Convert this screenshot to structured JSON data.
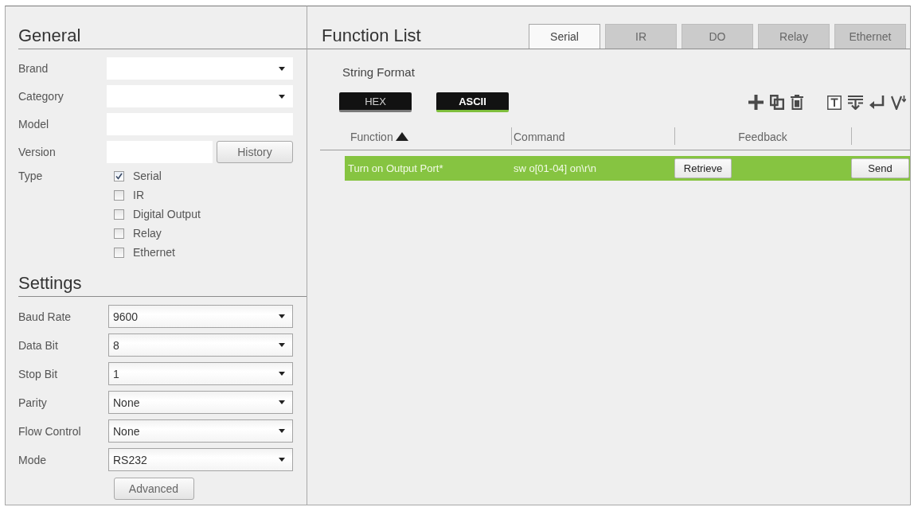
{
  "general": {
    "title": "General",
    "fields": [
      {
        "label": "Brand",
        "kind": "dropdown"
      },
      {
        "label": "Category",
        "kind": "dropdown"
      },
      {
        "label": "Model",
        "kind": "text"
      },
      {
        "label": "Version",
        "kind": "text_with_button",
        "button": "History"
      }
    ],
    "type": {
      "label": "Type",
      "options": [
        {
          "label": "Serial",
          "checked": true
        },
        {
          "label": "IR",
          "checked": false
        },
        {
          "label": "Digital Output",
          "checked": false
        },
        {
          "label": "Relay",
          "checked": false
        },
        {
          "label": "Ethernet",
          "checked": false
        }
      ]
    }
  },
  "settings": {
    "title": "Settings",
    "fields": [
      {
        "label": "Baud Rate",
        "value": "9600"
      },
      {
        "label": "Data Bit",
        "value": "8"
      },
      {
        "label": "Stop Bit",
        "value": "1"
      },
      {
        "label": "Parity",
        "value": "None"
      },
      {
        "label": "Flow Control",
        "value": "None"
      },
      {
        "label": "Mode",
        "value": "RS232"
      }
    ],
    "button": "Advanced"
  },
  "function_list": {
    "title": "Function List",
    "tabs": [
      {
        "label": "Serial",
        "selected": true,
        "disabled": false
      },
      {
        "label": "IR",
        "selected": false,
        "disabled": true
      },
      {
        "label": "DO",
        "selected": false,
        "disabled": true
      },
      {
        "label": "Relay",
        "selected": false,
        "disabled": true
      },
      {
        "label": "Ethernet",
        "selected": false,
        "disabled": true
      }
    ],
    "string_format": {
      "label": "String Format",
      "options": [
        {
          "label": "HEX",
          "selected": false
        },
        {
          "label": "ASCII",
          "selected": true
        }
      ]
    },
    "table": {
      "columns": [
        {
          "label": "Function",
          "sorted": true
        },
        {
          "label": "Command",
          "sorted": false
        },
        {
          "label": "Feedback",
          "sorted": false
        }
      ],
      "rows": [
        {
          "function": "Turn on Output Port*",
          "command": "sw o[01-04] on\\r\\n",
          "retrieve_button": "Retrieve",
          "send_button": "Send",
          "selected": true
        }
      ]
    }
  }
}
